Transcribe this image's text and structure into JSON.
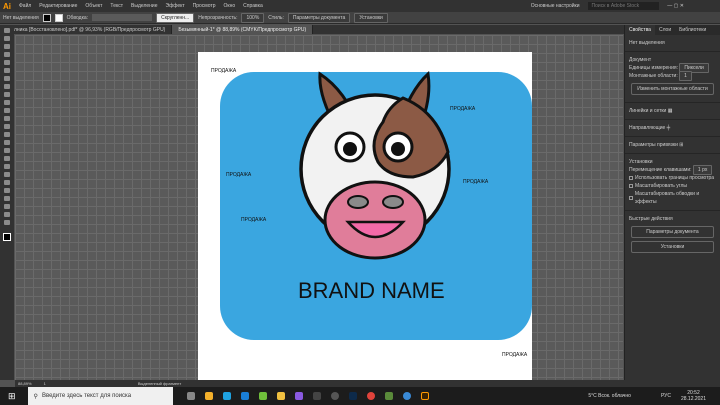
{
  "menu": {
    "logo": "Ai",
    "items": [
      "Файл",
      "Редактирование",
      "Объект",
      "Текст",
      "Выделение",
      "Эффект",
      "Просмотр",
      "Окно",
      "Справка"
    ],
    "workspace": "Основные настройки",
    "stock_placeholder": "Поиск в Adobe Stock"
  },
  "control": {
    "no_selection": "Нет выделения",
    "stroke_label": "Обводка:",
    "brush": "Скругленн...",
    "opacity_label": "Непрозрачность:",
    "opacity": "100%",
    "style_label": "Стиль:",
    "doc_settings": "Параметры документа",
    "prefs": "Установки"
  },
  "tabs": [
    {
      "label": "лника [Восстановлено].pdf* @ 96,93% (RGB/Предпросмотр GPU)"
    },
    {
      "label": "Безымянный-1* @ 88,89% (CMYK/Предпросмотр GPU)"
    }
  ],
  "artwork": {
    "brand": "BRAND NAME",
    "sale": "ПРОДАЖА",
    "colors": {
      "blue": "#3aa6e0",
      "brown": "#8c5a45",
      "snout": "#e07d9a",
      "mouth": "#f26aa8",
      "nostril": "#8a8a8a"
    }
  },
  "panel": {
    "tabs": [
      "Свойства",
      "Слои",
      "Библиотеки"
    ],
    "no_selection": "Нет выделения",
    "document": "Документ",
    "units_label": "Единицы измерения:",
    "units": "Пиксели",
    "artboards_label": "Монтажные области:",
    "artboards": "1",
    "edit_artboards": "Изменить монтажные области",
    "rulers": "Линейки и сетки",
    "guides": "Направляющие",
    "snap": "Параметры привязки",
    "prefs": "Установки",
    "key_inc_label": "Перемещение клавишами:",
    "key_inc": "1 px",
    "checks": [
      "Использовать границы просмотра",
      "Масштабировать углы",
      "Масштабировать обводки и эффекты"
    ],
    "quick": "Быстрые действия",
    "doc_settings": "Параметры документа",
    "prefs_btn": "Установки"
  },
  "status": {
    "zoom": "88,89%",
    "page": "1",
    "tool": "Выделенный фрагмент"
  },
  "taskbar": {
    "search": "Введите здесь текст для поиска",
    "weather": "5°C Всок. облачно",
    "lang": "РУС",
    "time": "20:52",
    "date": "28.12.2021"
  }
}
